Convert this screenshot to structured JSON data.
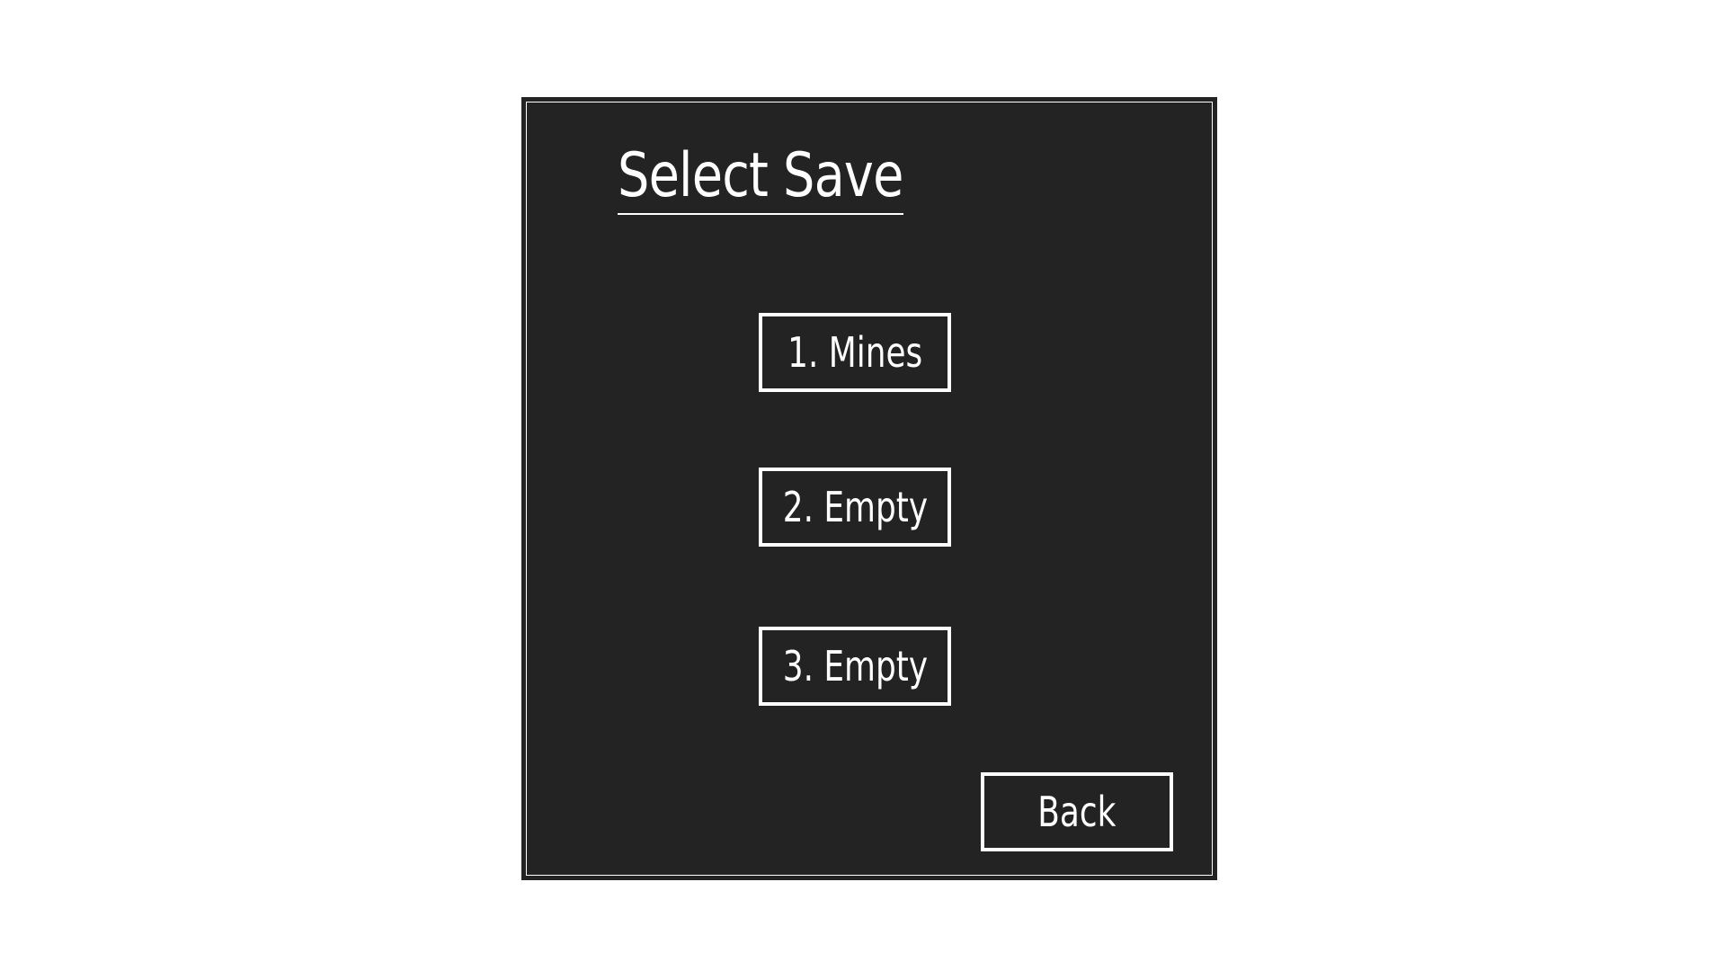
{
  "dialog": {
    "title": "Select Save",
    "slots": [
      {
        "label": "1. Mines"
      },
      {
        "label": "2. Empty"
      },
      {
        "label": "3. Empty"
      }
    ],
    "back_label": "Back"
  },
  "colors": {
    "page_background": "#ffffff",
    "dialog_background": "#232323",
    "text": "#ffffff",
    "button_border": "#ffffff"
  }
}
